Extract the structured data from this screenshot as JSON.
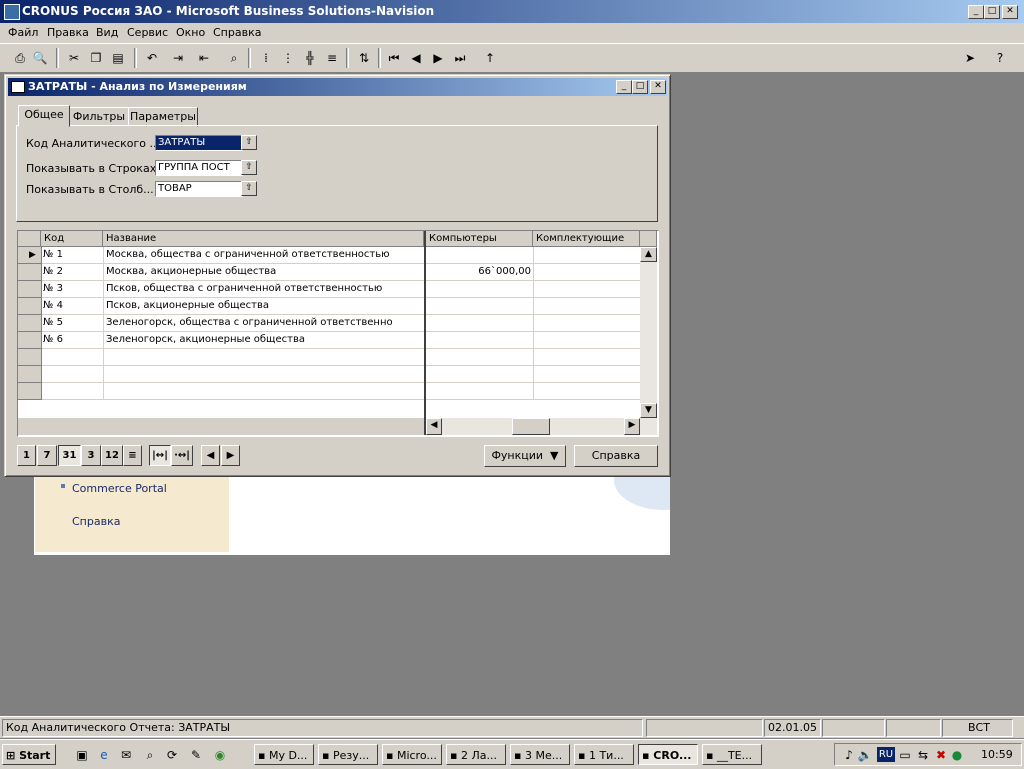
{
  "app": {
    "title": "CRONUS Россия ЗАО - Microsoft Business Solutions-Navision",
    "controls": {
      "minimize": "_",
      "maximize": "□",
      "close": "✕"
    }
  },
  "menu": [
    "Файл",
    "Правка",
    "Вид",
    "Сервис",
    "Окно",
    "Справка"
  ],
  "toolbar_icons": [
    "print-icon",
    "preview-icon",
    "cut-icon",
    "copy-icon",
    "paste-icon",
    "undo-icon",
    "indent-icon",
    "outdent-icon",
    "find-icon",
    "tile-icon",
    "grid-icon",
    "split-icon",
    "list-icon",
    "sort-icon",
    "first-record-icon",
    "prev-record-icon",
    "next-record-icon",
    "last-record-icon",
    "up-icon",
    "navigator-icon",
    "help-icon"
  ],
  "dialog": {
    "title": "ЗАТРАТЫ - Анализ по Измерениям",
    "tabs": [
      "Общее",
      "Фильтры",
      "Параметры"
    ],
    "fields": [
      {
        "label": "Код Аналитического ...",
        "value": "ЗАТРАТЫ"
      },
      {
        "label": "Показывать в Строках",
        "value": "ГРУППА ПОСТ"
      },
      {
        "label": "Показывать в Столб...",
        "value": "ТОВАР"
      }
    ],
    "grid": {
      "columns": [
        "Код",
        "Название",
        "Компьютеры",
        "Комплектующие"
      ],
      "rows": [
        {
          "code": "№ 1",
          "name": "Москва, общества с ограниченной ответственностью",
          "computers": "",
          "components": ""
        },
        {
          "code": "№ 2",
          "name": "Москва, акционерные общества",
          "computers": "66`000,00",
          "components": ""
        },
        {
          "code": "№ 3",
          "name": "Псков, общества с ограниченной ответственностью",
          "computers": "",
          "components": ""
        },
        {
          "code": "№ 4",
          "name": "Псков, акционерные общества",
          "computers": "",
          "components": ""
        },
        {
          "code": "№ 5",
          "name": "Зеленогорск, общества с ограниченной ответственно",
          "computers": "",
          "components": ""
        },
        {
          "code": "№ 6",
          "name": "Зеленогорск, акционерные общества",
          "computers": "",
          "components": ""
        }
      ]
    },
    "period_buttons": [
      "1",
      "7",
      "31",
      "3",
      "12",
      "≡"
    ],
    "functions_button": "Функции",
    "help_button": "Справка"
  },
  "background_window": {
    "links": [
      "Commerce Portal",
      "Справка"
    ]
  },
  "statusbar": {
    "message": "Код Аналитического Отчета: ЗАТРАТЫ",
    "date": "02.01.05",
    "mode": "ВСТ"
  },
  "taskbar": {
    "start": "Start",
    "tasks": [
      "My D...",
      "Резу...",
      "Micro...",
      "2 Ла...",
      "3 Ме...",
      "1 Ти...",
      "CRO...",
      "__TE..."
    ],
    "lang": "RU",
    "clock": "10:59"
  }
}
